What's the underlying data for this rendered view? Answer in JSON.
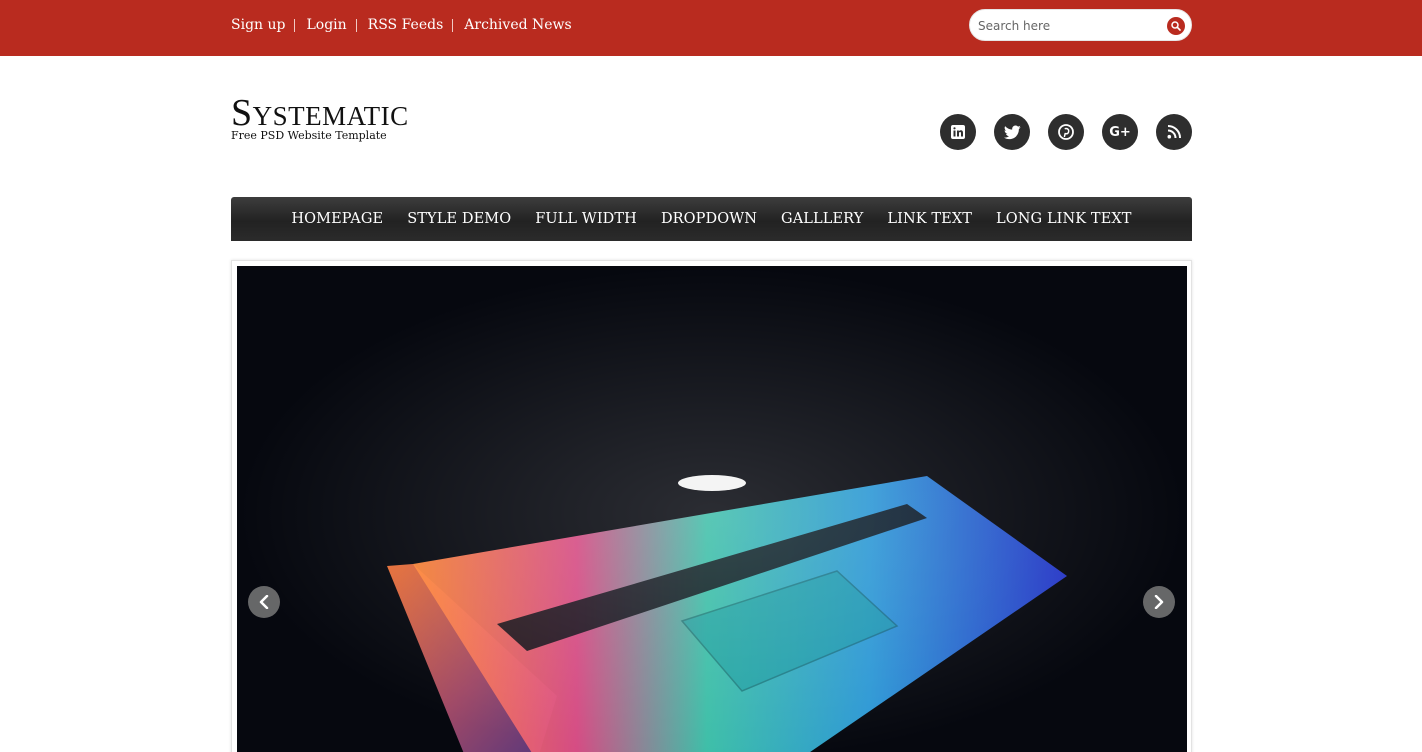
{
  "topbar": {
    "links": [
      "Sign up",
      "Login",
      "RSS Feeds",
      "Archived News"
    ],
    "search_placeholder": "Search here",
    "bg_color": "#b92b1f"
  },
  "header": {
    "title": "Systematic",
    "subtitle": "Free PSD Website Template",
    "social": [
      {
        "icon": "linkedin-icon",
        "glyph": "in"
      },
      {
        "icon": "twitter-icon",
        "glyph": ""
      },
      {
        "icon": "pinterest-icon",
        "glyph": ""
      },
      {
        "icon": "google-plus-icon",
        "glyph": "G+"
      },
      {
        "icon": "rss-icon",
        "glyph": ""
      }
    ]
  },
  "nav": {
    "items": [
      "HOMEPAGE",
      "STYLE DEMO",
      "FULL WIDTH",
      "DROPDOWN",
      "GALLLERY",
      "LINK TEXT",
      "LONG LINK TEXT"
    ]
  },
  "slider": {
    "image": "laptop-keyboard-photo"
  }
}
